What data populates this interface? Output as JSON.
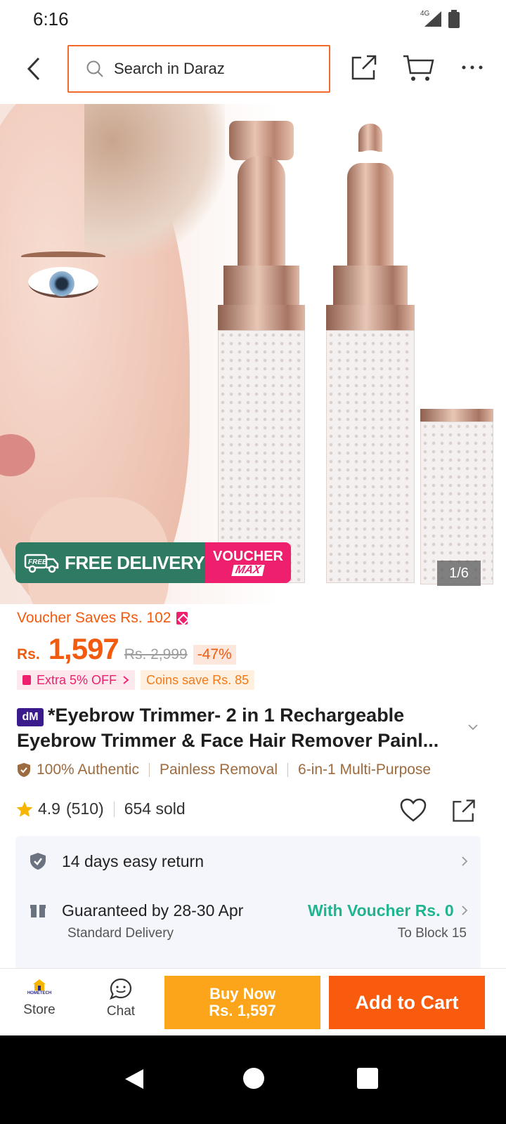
{
  "status_bar": {
    "time": "6:16",
    "network": "4G"
  },
  "search": {
    "placeholder": "Search in Daraz"
  },
  "gallery": {
    "counter": "1/6"
  },
  "promo": {
    "free_delivery": "FREE DELIVERY",
    "voucher": "VOUCHER",
    "max": "MAX",
    "truck_label": "FREE"
  },
  "voucher_saves": "Voucher Saves Rs. 102",
  "price": {
    "currency": "Rs.",
    "current": "1,597",
    "original": "Rs. 2,999",
    "discount": "-47%"
  },
  "badges": {
    "extra": "Extra 5% OFF",
    "coins": "Coins save Rs. 85"
  },
  "product": {
    "brand_badge": "dM",
    "title": "*Eyebrow Trimmer- 2 in 1 Rechargeable Eyebrow Trimmer & Face Hair Remover Painl..."
  },
  "features": [
    "100% Authentic",
    "Painless Removal",
    "6-in-1 Multi-Purpose"
  ],
  "rating": {
    "score": "4.9",
    "count": "(510)",
    "sold": "654 sold"
  },
  "service": {
    "return": "14 days easy return",
    "delivery": "Guaranteed by 28-30 Apr",
    "voucher": "With Voucher Rs. 0",
    "standard": "Standard Delivery",
    "to": "To Block 15"
  },
  "bottom": {
    "store_label": "Store",
    "store_logo_text": "HOMETECH",
    "chat_label": "Chat",
    "buy_now_line1": "Buy Now",
    "buy_now_line2": "Rs. 1,597",
    "add_to_cart": "Add to Cart"
  },
  "colors": {
    "accent": "#f95b0e",
    "buy_now": "#fca51b",
    "voucher_pink": "#ee1f6c",
    "delivery_green": "#2f7a62",
    "with_voucher": "#1fb58f"
  }
}
